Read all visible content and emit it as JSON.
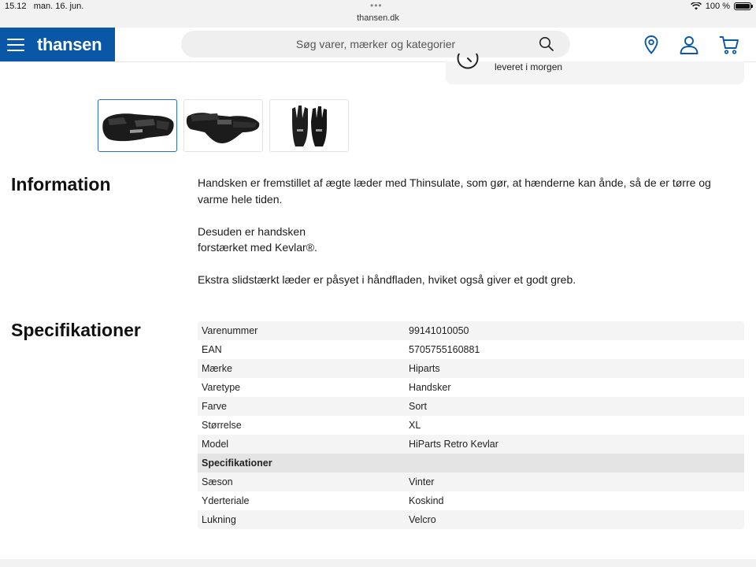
{
  "status_bar": {
    "time": "15.12",
    "date": "man. 16. jun.",
    "dots": "•••",
    "url": "thansen.dk",
    "battery": "100 %",
    "battery_level": 1.0
  },
  "header": {
    "logo": "thansen",
    "search_placeholder": "Søg varer, mærker og kategorier",
    "icons": [
      "menu-icon",
      "search-icon",
      "location-pin-icon",
      "account-icon",
      "cart-icon"
    ]
  },
  "delivery": {
    "text": "leveret i morgen"
  },
  "thumbnails": [
    {
      "name": "glove-side-view",
      "active": true
    },
    {
      "name": "glove-back-view",
      "active": false
    },
    {
      "name": "glove-pair-front-view",
      "active": false
    }
  ],
  "information": {
    "title": "Information",
    "paragraphs": [
      "Handsken er fremstillet af ægte læder med Thinsulate, som gør, at hænderne kan ånde, så de er tørre og varme hele tiden.",
      "Desuden er handsken\nforstærket med Kevlar®.",
      "Ekstra slidstærkt læder er påsyet i håndfladen, hviket også giver et godt greb."
    ]
  },
  "specifications": {
    "title": "Specifikationer",
    "rows": [
      {
        "label": "Varenummer",
        "value": "99141010050"
      },
      {
        "label": "EAN",
        "value": "5705755160881"
      },
      {
        "label": "Mærke",
        "value": "Hiparts"
      },
      {
        "label": "Varetype",
        "value": "Handsker"
      },
      {
        "label": "Farve",
        "value": "Sort"
      },
      {
        "label": "Størrelse",
        "value": "XL"
      },
      {
        "label": "Model",
        "value": "HiParts Retro Kevlar"
      },
      {
        "label": "Specifikationer",
        "value": "",
        "group": true
      },
      {
        "label": "Sæson",
        "value": "Vinter"
      },
      {
        "label": "Yderteriale",
        "value": "Koskind"
      },
      {
        "label": "Lukning",
        "value": "Velcro"
      }
    ]
  },
  "colors": {
    "brand": "#0a57a8",
    "active_thumb_border": "#2a6fb8"
  }
}
